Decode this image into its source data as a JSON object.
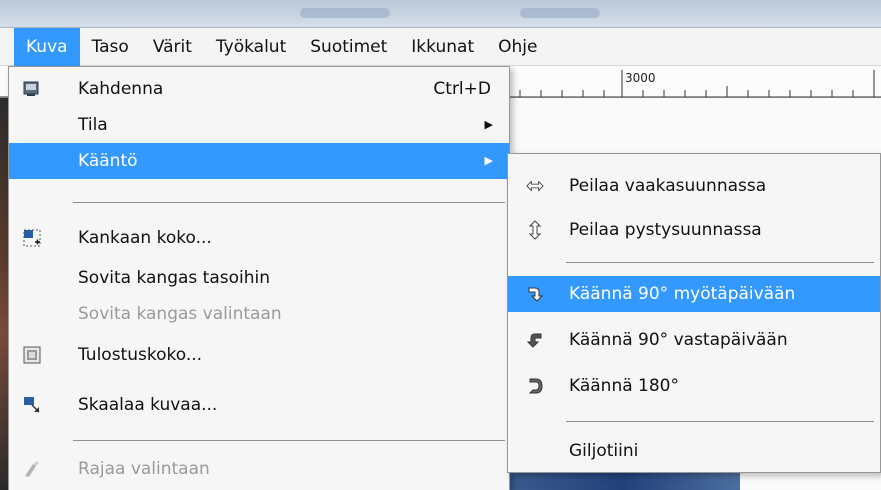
{
  "menubar": {
    "items": [
      {
        "label": "Kuva",
        "active": true
      },
      {
        "label": "Taso",
        "active": false
      },
      {
        "label": "Värit",
        "active": false
      },
      {
        "label": "Työkalut",
        "active": false
      },
      {
        "label": "Suotimet",
        "active": false
      },
      {
        "label": "Ikkunat",
        "active": false
      },
      {
        "label": "Ohje",
        "active": false
      }
    ]
  },
  "ruler": {
    "label": "3000"
  },
  "image_menu": {
    "duplicate": {
      "label": "Kahdenna",
      "shortcut": "Ctrl+D",
      "icon": "duplicate-icon"
    },
    "mode": {
      "label": "Tila"
    },
    "transform": {
      "label": "Kääntö"
    },
    "canvas_size": {
      "label": "Kankaan koko...",
      "icon": "canvas-size-icon"
    },
    "fit_canvas_layers": {
      "label": "Sovita kangas tasoihin"
    },
    "fit_canvas_selection": {
      "label": "Sovita kangas valintaan"
    },
    "print_size": {
      "label": "Tulostuskoko...",
      "icon": "print-size-icon"
    },
    "scale_image": {
      "label": "Skaalaa kuvaa...",
      "icon": "scale-image-icon"
    },
    "crop_selection": {
      "label": "Rajaa valintaan",
      "icon": "crop-icon"
    }
  },
  "transform_menu": {
    "flip_horizontal": {
      "label": "Peilaa vaakasuunnassa",
      "icon": "flip-horizontal-icon"
    },
    "flip_vertical": {
      "label": "Peilaa pystysuunnassa",
      "icon": "flip-vertical-icon"
    },
    "rotate_cw": {
      "label": "Käännä 90° myötäpäivään",
      "icon": "rotate-cw-icon"
    },
    "rotate_ccw": {
      "label": "Käännä 90° vastapäivään",
      "icon": "rotate-ccw-icon"
    },
    "rotate_180": {
      "label": "Käännä 180°",
      "icon": "rotate-180-icon"
    },
    "guillotine": {
      "label": "Giljotiini"
    }
  },
  "colors": {
    "highlight": "#3399ff",
    "menu_bg": "#f6f6f6",
    "disabled_text": "#9a9a9a"
  }
}
